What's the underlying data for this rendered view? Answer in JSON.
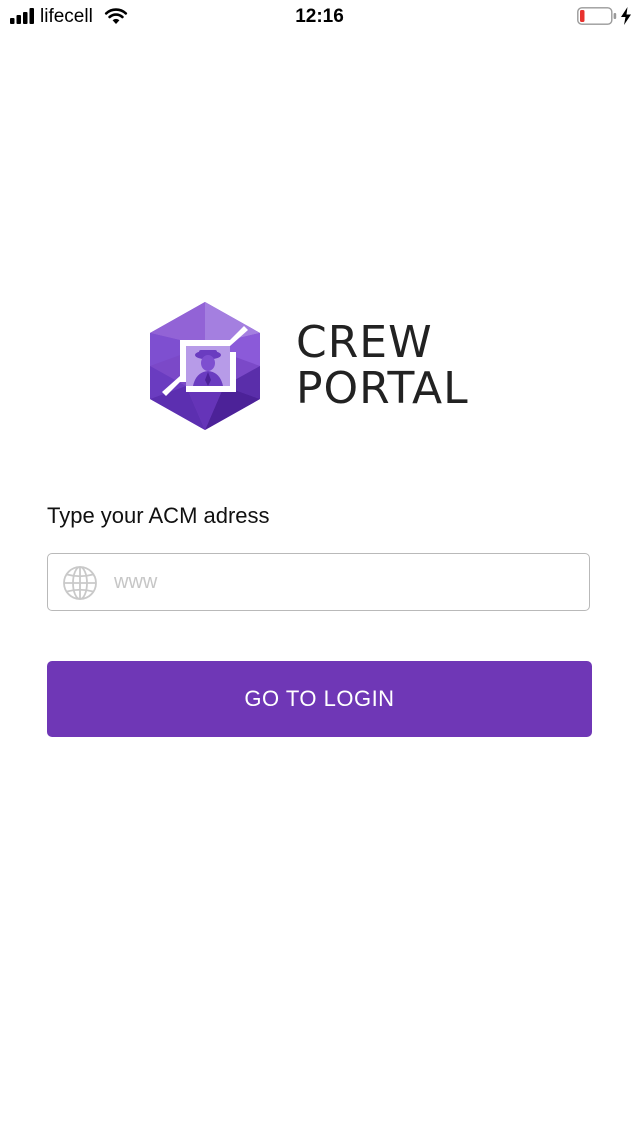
{
  "status_bar": {
    "carrier": "lifecell",
    "time": "12:16",
    "battery_level": 0.15,
    "charging": true
  },
  "logo": {
    "line1": "CREW",
    "line2": "PORTAL",
    "brand_color": "#7b49c8"
  },
  "form": {
    "label": "Type your ACM adress",
    "address_placeholder": "www",
    "address_value": "",
    "submit_label": "GO TO LOGIN",
    "button_color": "#6f37b6"
  }
}
